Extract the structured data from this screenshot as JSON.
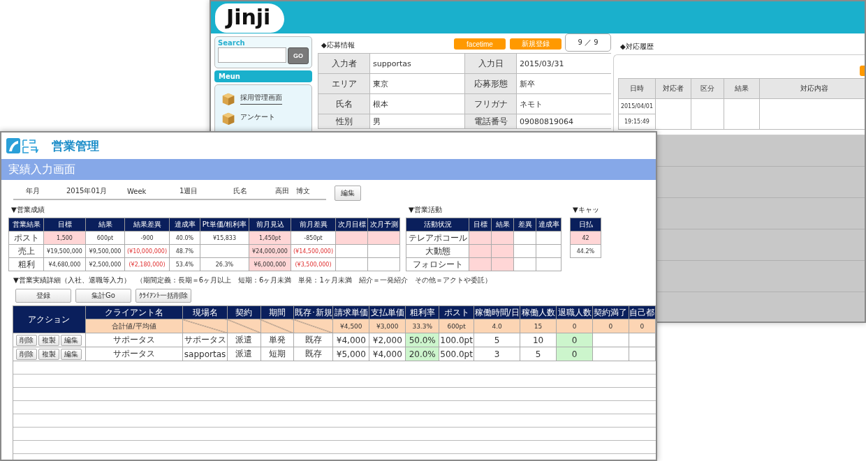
{
  "back_window": {
    "logo": "Jinji",
    "search": {
      "label": "Search",
      "button": "GO"
    },
    "menu": {
      "title": "Meun",
      "items": [
        {
          "label": "採用管理画面",
          "selected": true
        },
        {
          "label": "アンケート",
          "selected": false
        }
      ]
    },
    "applicant": {
      "heading": "◆応募情報",
      "buttons": [
        "facetime",
        "新規登録"
      ],
      "page_counter": "9 ／ 9",
      "fields": [
        {
          "label": "入力者",
          "value": "supportas"
        },
        {
          "label": "入力日",
          "value": "2015/03/31"
        },
        {
          "label": "エリア",
          "value": "東京"
        },
        {
          "label": "応募形態",
          "value": "新卒"
        },
        {
          "label": "氏名",
          "value": "根本"
        },
        {
          "label": "フリガナ",
          "value": "ネモト"
        },
        {
          "label": "性別",
          "value": "男"
        },
        {
          "label": "電話番号",
          "value": "09080819064"
        }
      ]
    },
    "history": {
      "heading": "◆対応履歴",
      "columns": [
        "日時",
        "対応者",
        "区分",
        "結果",
        "対応内容"
      ],
      "rows": [
        {
          "date": "2015/04/01",
          "time": "19:15:49"
        }
      ]
    }
  },
  "front_window": {
    "app_name": "営業管理",
    "screen_title": "実績入力画面",
    "info": [
      {
        "label": "年月",
        "value": "2015年01月"
      },
      {
        "label": "Week",
        "value": "1週目"
      },
      {
        "label": "氏名",
        "value": "高田　博文"
      }
    ],
    "edit_button": "編集",
    "sales_results": {
      "heading": "▼営業成績",
      "columns": [
        "営業結果",
        "目標",
        "結果",
        "結果差異",
        "達成率",
        "Pt単価/粗利率",
        "前月見込",
        "前月差異",
        "次月目標",
        "次月予測"
      ],
      "rows": [
        [
          "ポスト",
          {
            "text": "1,500",
            "color": "#ffd6d6"
          },
          "600pt",
          "-900",
          "40.0%",
          "¥15,833",
          {
            "text": "1,450pt",
            "color": "#ffd6d6"
          },
          "-850pt",
          {
            "color": "#ffd6d6"
          },
          {
            "color": "#ffd6d6"
          }
        ],
        [
          "売上",
          "¥19,500,000",
          "¥9,500,000",
          {
            "text": "(¥10,000,000)",
            "negative": true
          },
          "48.7%",
          null,
          {
            "text": "¥24,000,000",
            "color": "#ffd6d6"
          },
          {
            "text": "(¥14,500,000)",
            "negative": true
          },
          null,
          null
        ],
        [
          "粗利",
          "¥4,680,000",
          "¥2,500,000",
          {
            "text": "(¥2,180,000)",
            "negative": true
          },
          "53.4%",
          "26.3%",
          {
            "text": "¥6,000,000",
            "color": "#ffd6d6"
          },
          {
            "text": "(¥3,500,000)",
            "negative": true
          },
          null,
          null
        ]
      ]
    },
    "sales_activity": {
      "heading": "▼営業活動",
      "columns": [
        "活動状況",
        "目標",
        "結果",
        "差異",
        "達成率"
      ],
      "rows": [
        [
          "テレアポコール",
          {
            "color": "#ffd6d6"
          },
          {
            "color": "#ffd6d6"
          },
          null,
          null
        ],
        [
          "大動態",
          {
            "color": "#ffd6d6"
          },
          {
            "color": "#ffd6d6"
          },
          null,
          null
        ],
        [
          "フォロシート",
          {
            "color": "#ffd6d6"
          },
          {
            "color": "#ffd6d6"
          },
          null,
          null
        ]
      ]
    },
    "cash": {
      "heading": "▼キャッ",
      "columns": [
        "日払"
      ],
      "rows": [
        [
          {
            "text": "42",
            "color": "#ffd6d6"
          }
        ],
        [
          "44.2%"
        ]
      ]
    },
    "detail": {
      "heading": "▼営業実績詳細（入社、退職等入力）",
      "note": "（期間定義：長期＝6ヶ月以上　短期：6ヶ月未満　単発：1ヶ月未満　紹介＝一発紹介　その他＝アクトや委託）",
      "buttons": [
        "登録",
        "集計Go",
        "ｸﾗｲｱﾝﾄ一括削除"
      ],
      "action_header": "アクション",
      "columns": [
        "クライアント名",
        "現場名",
        "契約",
        "期間",
        "既存･新規",
        "請求単価",
        "支払単価",
        "粗利率",
        "ポスト",
        "稼働時間/日",
        "稼働人数",
        "退職人数",
        "契約満了",
        "自己都"
      ],
      "summary": [
        {
          "kind": "text",
          "text": "合計値/平均値"
        },
        {
          "kind": "slash"
        },
        {
          "kind": "slash"
        },
        {
          "kind": "slash"
        },
        {
          "kind": "slash"
        },
        {
          "kind": "text",
          "text": "¥4,500"
        },
        {
          "kind": "text",
          "text": "¥3,000"
        },
        {
          "kind": "text",
          "text": "33.3%"
        },
        {
          "kind": "text",
          "text": "600pt"
        },
        {
          "kind": "text",
          "text": "4.0"
        },
        {
          "kind": "text",
          "text": "15"
        },
        {
          "kind": "text",
          "text": "0"
        },
        {
          "kind": "text",
          "text": "0"
        },
        {
          "kind": "text",
          "text": "0"
        }
      ],
      "rows": [
        {
          "actions": [
            "削除",
            "複製",
            "編集"
          ],
          "cells": [
            "サポータス",
            "サポータス",
            "派遣",
            "単発",
            "既存",
            "¥4,000",
            "¥2,000",
            {
              "text": "50.0%",
              "color": "#ccf5cc"
            },
            "100.0pt",
            "5",
            "10",
            {
              "text": "0",
              "color": "#ccf5cc"
            },
            null,
            null
          ]
        },
        {
          "actions": [
            "削除",
            "複製",
            "編集"
          ],
          "cells": [
            "サポータス",
            "sapportas",
            "派遣",
            "短期",
            "既存",
            "¥5,000",
            "¥4,000",
            {
              "text": "20.0%",
              "color": "#ccf5cc"
            },
            "500.0pt",
            "3",
            "5",
            {
              "text": "0",
              "color": "#ccf5cc"
            },
            null,
            null
          ]
        }
      ]
    }
  }
}
